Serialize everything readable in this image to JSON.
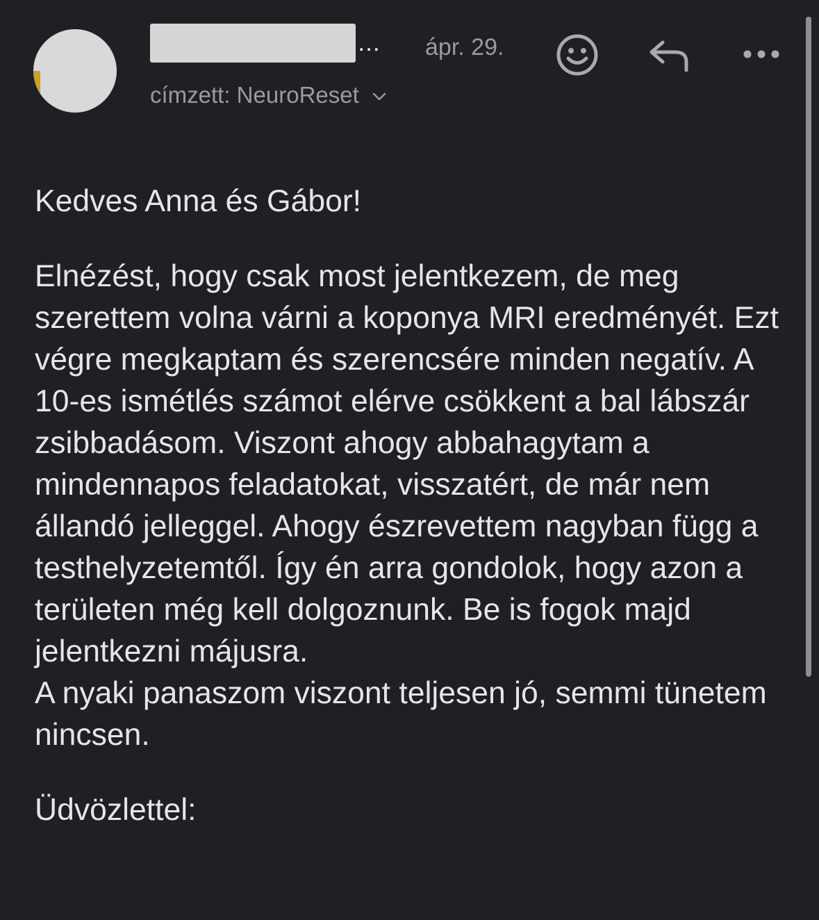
{
  "header": {
    "sender_suffix": "…",
    "date": "ápr. 29.",
    "recipient_text": "címzett: NeuroReset",
    "icons": {
      "emoji": "smiley-face-icon",
      "reply": "reply-arrow-icon",
      "more": "more-dots-icon",
      "expand": "chevron-down-icon"
    }
  },
  "message": {
    "greeting": "Kedves Anna és Gábor!",
    "paragraph_1": "Elnézést, hogy csak most jelentkezem, de meg szerettem volna várni a koponya MRI eredményét. Ezt végre megkaptam és szerencsére minden negatív. A 10-es ismétlés számot elérve csökkent a bal lábszár zsibbadásom. Viszont ahogy abbahagytam a mindennapos feladatokat, visszatért, de már nem állandó jelleggel. Ahogy észrevettem nagyban függ a testhelyzetemtől. Így én arra gondolok, hogy azon a területen még kell dolgoznunk. Be is fogok majd jelentkezni májusra.",
    "paragraph_2": "A nyaki panaszom viszont teljesen jó, semmi tünetem nincsen.",
    "closing": "Üdvözlettel:"
  },
  "colors": {
    "background": "#1f2023",
    "text_primary": "#e6e6e8",
    "text_secondary": "#9a9ba0",
    "avatar": "#d9d9d9",
    "redaction": "#d6d6d6"
  }
}
